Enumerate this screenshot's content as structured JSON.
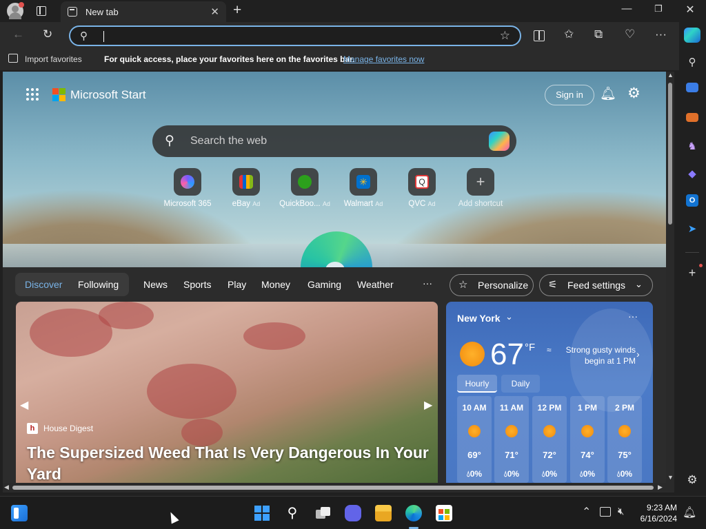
{
  "titlebar": {
    "tab_title": "New tab",
    "minimize_icon": "minimize-icon",
    "restore_icon": "restore-icon",
    "close_icon": "close-icon"
  },
  "favorites_bar": {
    "import_label": "Import favorites",
    "message": "For quick access, place your favorites here on the favorites bar.",
    "manage_link": "Manage favorites now"
  },
  "start": {
    "brand": "Microsoft Start",
    "sign_in": "Sign in",
    "search_placeholder": "Search the web",
    "shortcuts": [
      {
        "label": "Microsoft 365",
        "ad": ""
      },
      {
        "label": "eBay",
        "ad": "Ad"
      },
      {
        "label": "QuickBoo...",
        "ad": "Ad"
      },
      {
        "label": "Walmart",
        "ad": "Ad"
      },
      {
        "label": "QVC",
        "ad": "Ad"
      },
      {
        "label": "Add shortcut",
        "ad": ""
      }
    ]
  },
  "feed_nav": {
    "items": [
      "Discover",
      "Following",
      "News",
      "Sports",
      "Play",
      "Money",
      "Gaming",
      "Weather"
    ],
    "more": "···",
    "personalize": "Personalize",
    "feed_settings": "Feed settings"
  },
  "hero": {
    "source": "House Digest",
    "headline": "The Supersized Weed That Is Very Dangerous In Your Yard"
  },
  "weather": {
    "city": "New York",
    "temp": "67",
    "unit": "°F",
    "description": "Strong gusty winds begin at 1 PM",
    "tabs": [
      "Hourly",
      "Daily"
    ],
    "hours": [
      {
        "time": "10 AM",
        "temp": "69°",
        "precip": "0%"
      },
      {
        "time": "11 AM",
        "temp": "71°",
        "precip": "0%"
      },
      {
        "time": "12 PM",
        "temp": "72°",
        "precip": "0%"
      },
      {
        "time": "1 PM",
        "temp": "74°",
        "precip": "0%"
      },
      {
        "time": "2 PM",
        "temp": "75°",
        "precip": "0%"
      }
    ]
  },
  "taskbar": {
    "time": "9:23 AM",
    "date": "6/16/2024"
  },
  "colors": {
    "accent": "#7ab4e8",
    "discover": "#7ab4e8",
    "weather_bg": "#4a78c4"
  }
}
